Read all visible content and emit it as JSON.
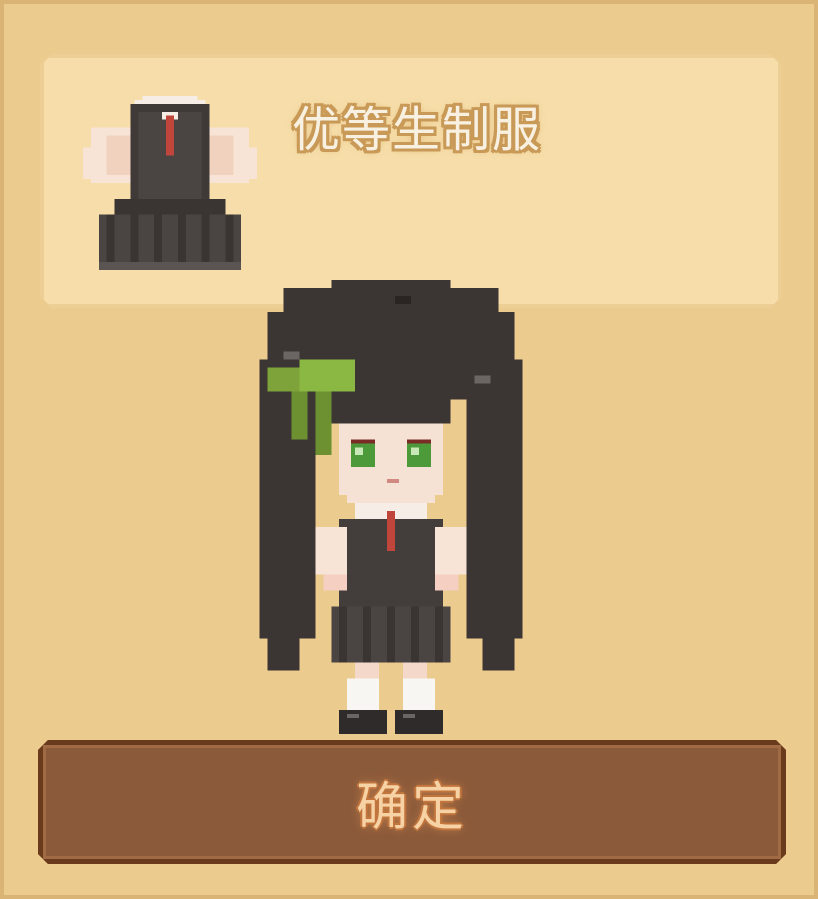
{
  "item": {
    "name": "优等生制服",
    "icon": "school-uniform-icon"
  },
  "preview": {
    "character": "girl-character"
  },
  "confirm_button": {
    "label": "确定"
  }
}
